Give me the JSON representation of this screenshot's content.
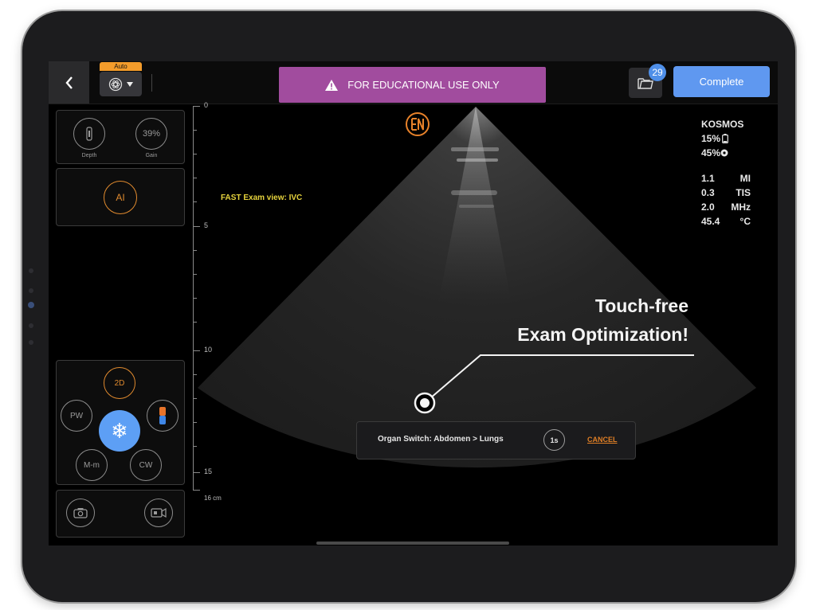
{
  "topbar": {
    "auto_label": "Auto",
    "edu_banner_text": "FOR EDUCATIONAL USE ONLY",
    "exam_count": "29",
    "complete_label": "Complete"
  },
  "controls": {
    "depth_label": "Depth",
    "gain_value": "39%",
    "gain_label": "Gain",
    "ai_label": "AI",
    "mode_2d": "2D",
    "mode_pw": "PW",
    "mode_mm": "M-m",
    "mode_cw": "CW"
  },
  "image": {
    "view_label": "FAST Exam view: IVC",
    "scale": {
      "ticks": [
        "0",
        "5",
        "10",
        "15"
      ],
      "unit_label": "16 cm"
    }
  },
  "readouts": {
    "device": "KOSMOS",
    "battery_percent": "15%",
    "battery_icon": "battery-icon",
    "other_percent": "45%",
    "other_icon": "circle-dot-icon",
    "params": [
      {
        "value": "1.1",
        "unit": "MI"
      },
      {
        "value": "0.3",
        "unit": "TIS"
      },
      {
        "value": "2.0",
        "unit": "MHz"
      },
      {
        "value": "45.4",
        "unit": "°C"
      }
    ]
  },
  "overlay": {
    "headline_line1": "Touch-free",
    "headline_line2": "Exam Optimization!"
  },
  "toast": {
    "text": "Organ Switch: Abdomen > Lungs",
    "timer": "1s",
    "cancel_label": "CANCEL"
  },
  "colors": {
    "accent_blue": "#5f98f0",
    "banner_purple": "#a14c9e",
    "ai_orange": "#e08a2e",
    "view_label_yellow": "#e6d33d"
  }
}
